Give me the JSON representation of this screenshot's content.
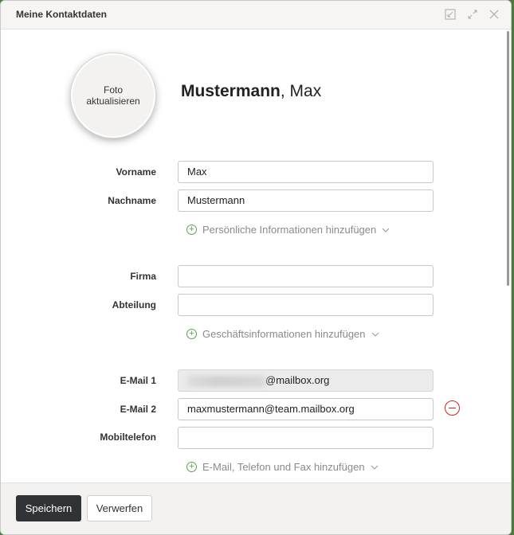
{
  "dialog": {
    "title": "Meine Kontaktdaten"
  },
  "header_icons": [
    "minimize-icon",
    "expand-icon",
    "close-icon"
  ],
  "photo": {
    "label": "Foto aktualisieren"
  },
  "name_display": {
    "last": "Mustermann",
    "separator": ",",
    "first": " Max"
  },
  "fields": {
    "vorname": {
      "label": "Vorname",
      "value": "Max"
    },
    "nachname": {
      "label": "Nachname",
      "value": "Mustermann"
    },
    "firma": {
      "label": "Firma",
      "value": ""
    },
    "abteilung": {
      "label": "Abteilung",
      "value": ""
    },
    "email1": {
      "label": "E-Mail 1",
      "value": "@mailbox.org"
    },
    "email2": {
      "label": "E-Mail 2",
      "value": "maxmustermann@team.mailbox.org"
    },
    "mobil": {
      "label": "Mobiltelefon",
      "value": ""
    }
  },
  "links": {
    "personal": "Persönliche Informationen hinzufügen",
    "business": "Geschäftsinformationen hinzufügen",
    "contact": "E-Mail, Telefon und Fax hinzufügen"
  },
  "footer": {
    "save": "Speichern",
    "discard": "Verwerfen"
  },
  "colors": {
    "accent_green": "#5aa34a",
    "remove_red": "#c8271e",
    "primary_button": "#2f3336"
  }
}
